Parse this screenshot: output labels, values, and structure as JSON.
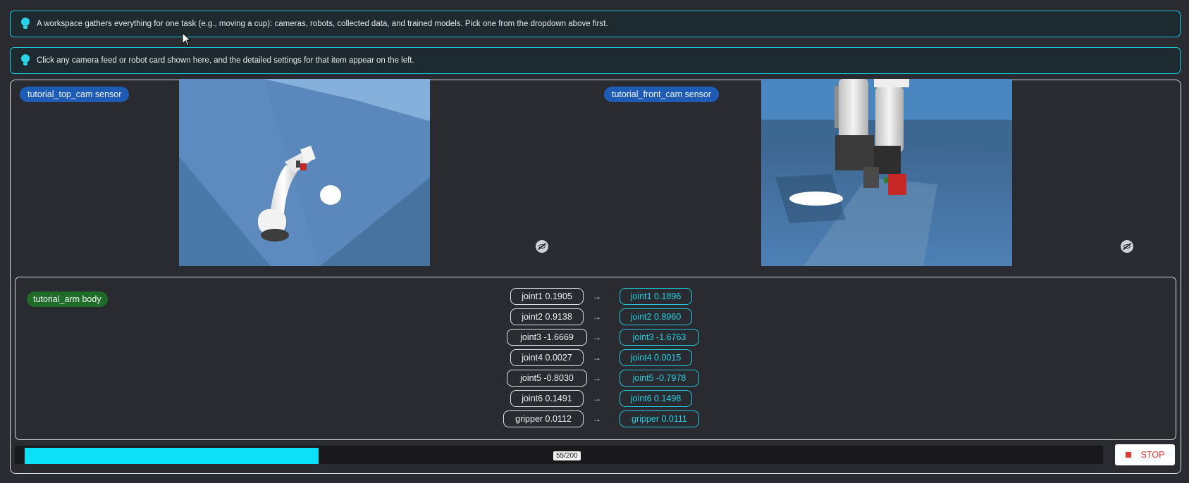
{
  "tips": [
    {
      "text": "A workspace gathers everything for one task (e.g., moving a cup): cameras, robots, collected data, and trained models. Pick one from the dropdown above first.",
      "icon": "lightbulb-icon"
    },
    {
      "text": "Click any camera feed or robot card shown here, and the detailed settings for that item appear on the left.",
      "icon": "lightbulb-icon"
    }
  ],
  "sensors": [
    {
      "label": "tutorial_top_cam sensor"
    },
    {
      "label": "tutorial_front_cam sensor"
    }
  ],
  "body": {
    "label": "tutorial_arm body",
    "joints": [
      {
        "current": "joint1 0.1905",
        "target": "joint1 0.1896"
      },
      {
        "current": "joint2 0.9138",
        "target": "joint2 0.8960"
      },
      {
        "current": "joint3 -1.6669",
        "target": "joint3 -1.6763"
      },
      {
        "current": "joint4 0.0027",
        "target": "joint4 0.0015"
      },
      {
        "current": "joint5 -0.8030",
        "target": "joint5 -0.7978"
      },
      {
        "current": "joint6 0.1491",
        "target": "joint6 0.1498"
      },
      {
        "current": "gripper 0.0112",
        "target": "gripper 0.0111"
      }
    ],
    "arrow": "→"
  },
  "progress": {
    "label": "55/200",
    "current": 55,
    "total": 200
  },
  "stop_label": "STOP",
  "colors": {
    "accent": "#0ae0f8",
    "sensor_tag": "#1e5bb5",
    "body_tag": "#1e6b2a",
    "stop": "#e53935"
  }
}
